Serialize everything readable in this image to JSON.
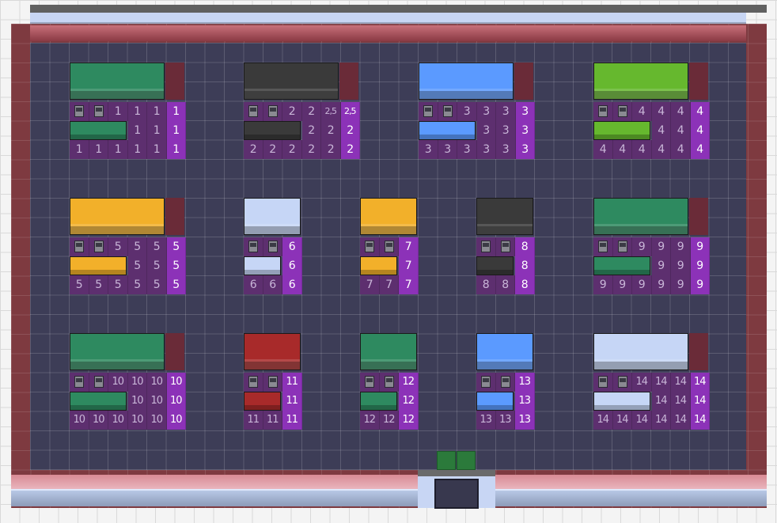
{
  "scene": {
    "floor_color": "#3d3d57",
    "wall_color": "#7e3a40",
    "door_mat_color": "#2b7a3b"
  },
  "stations": [
    {
      "id": 1,
      "color": "#2e8a60",
      "size": "wide",
      "row1": [
        "chair",
        "chair",
        "1",
        "1",
        "1",
        "1"
      ],
      "row2": [
        "board",
        "board",
        "board",
        "1",
        "1",
        "1"
      ],
      "row3": [
        "1",
        "1",
        "1",
        "1",
        "1",
        "1"
      ]
    },
    {
      "id": 2,
      "color": "#3a3a3a",
      "size": "wide",
      "row1": [
        "chair",
        "chair",
        "2",
        "2",
        "2,5",
        "2,5"
      ],
      "row2": [
        "board",
        "board",
        "board",
        "2",
        "2",
        "2"
      ],
      "row3": [
        "2",
        "2",
        "2",
        "2",
        "2",
        "2"
      ]
    },
    {
      "id": 3,
      "color": "#5b9aff",
      "size": "wide",
      "row1": [
        "chair",
        "chair",
        "3",
        "3",
        "3",
        "3"
      ],
      "row2": [
        "board",
        "board",
        "board",
        "3",
        "3",
        "3"
      ],
      "row3": [
        "3",
        "3",
        "3",
        "3",
        "3",
        "3"
      ]
    },
    {
      "id": 4,
      "color": "#66b82e",
      "size": "wide",
      "row1": [
        "chair",
        "chair",
        "4",
        "4",
        "4",
        "4"
      ],
      "row2": [
        "board",
        "board",
        "board",
        "4",
        "4",
        "4"
      ],
      "row3": [
        "4",
        "4",
        "4",
        "4",
        "4",
        "4"
      ]
    },
    {
      "id": 5,
      "color": "#f2b02a",
      "size": "wide",
      "row1": [
        "chair",
        "chair",
        "5",
        "5",
        "5",
        "5"
      ],
      "row2": [
        "board",
        "board",
        "board",
        "5",
        "5",
        "5"
      ],
      "row3": [
        "5",
        "5",
        "5",
        "5",
        "5",
        "5"
      ]
    },
    {
      "id": 6,
      "color": "#c6d6f6",
      "size": "small",
      "row1": [
        "chair",
        "chair",
        "6"
      ],
      "row2": [
        "board",
        "board",
        "6"
      ],
      "row3": [
        "6",
        "6",
        "6"
      ]
    },
    {
      "id": 7,
      "color": "#f2b02a",
      "size": "small",
      "row1": [
        "chair",
        "chair",
        "7"
      ],
      "row2": [
        "board",
        "board",
        "7"
      ],
      "row3": [
        "7",
        "7",
        "7"
      ]
    },
    {
      "id": 8,
      "color": "#3a3a3a",
      "size": "small",
      "row1": [
        "chair",
        "chair",
        "8"
      ],
      "row2": [
        "board",
        "board",
        "8"
      ],
      "row3": [
        "8",
        "8",
        "8"
      ]
    },
    {
      "id": 9,
      "color": "#2e8a60",
      "size": "wide",
      "row1": [
        "chair",
        "chair",
        "9",
        "9",
        "9",
        "9"
      ],
      "row2": [
        "board",
        "board",
        "board",
        "9",
        "9",
        "9"
      ],
      "row3": [
        "9",
        "9",
        "9",
        "9",
        "9",
        "9"
      ]
    },
    {
      "id": 10,
      "color": "#2e8a60",
      "size": "wide",
      "row1": [
        "chair",
        "chair",
        "10",
        "10",
        "10",
        "10"
      ],
      "row2": [
        "board",
        "board",
        "board",
        "10",
        "10",
        "10"
      ],
      "row3": [
        "10",
        "10",
        "10",
        "10",
        "10",
        "10"
      ]
    },
    {
      "id": 11,
      "color": "#a82a2a",
      "size": "small",
      "row1": [
        "chair",
        "chair",
        "11"
      ],
      "row2": [
        "board",
        "board",
        "11"
      ],
      "row3": [
        "11",
        "11",
        "11"
      ]
    },
    {
      "id": 12,
      "color": "#2e8a60",
      "size": "small",
      "row1": [
        "chair",
        "chair",
        "12"
      ],
      "row2": [
        "board",
        "board",
        "12"
      ],
      "row3": [
        "12",
        "12",
        "12"
      ]
    },
    {
      "id": 13,
      "color": "#5b9aff",
      "size": "small",
      "row1": [
        "chair",
        "chair",
        "13"
      ],
      "row2": [
        "board",
        "board",
        "13"
      ],
      "row3": [
        "13",
        "13",
        "13"
      ]
    },
    {
      "id": 14,
      "color": "#c6d6f6",
      "size": "wide",
      "row1": [
        "chair",
        "chair",
        "14",
        "14",
        "14",
        "14"
      ],
      "row2": [
        "board",
        "board",
        "board",
        "14",
        "14",
        "14"
      ],
      "row3": [
        "14",
        "14",
        "14",
        "14",
        "14",
        "14"
      ]
    }
  ]
}
